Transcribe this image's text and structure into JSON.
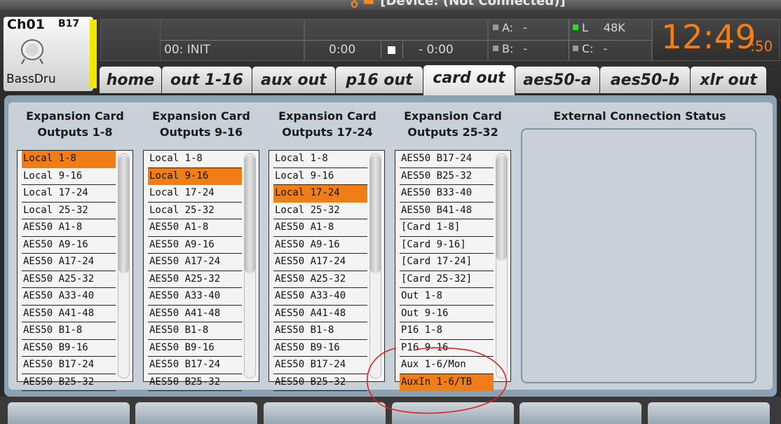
{
  "window": {
    "title": "[Device: (Not Connected)]"
  },
  "channel": {
    "number": "Ch01",
    "source": "B17",
    "name": "BassDru",
    "color": "#f3e600"
  },
  "scene": {
    "label": "00: INIT"
  },
  "transport": {
    "elapsed": "0:00",
    "remaining": "- 0:00"
  },
  "indicators": {
    "a": "A:",
    "a_val": "-",
    "b": "B:",
    "b_val": "-",
    "l": "L",
    "l_val": "48K",
    "c": "C:",
    "c_val": "-"
  },
  "clock": {
    "hm": "12:49",
    "sec": ":50",
    "color": "#f07d16"
  },
  "tabs": [
    {
      "label": "home"
    },
    {
      "label": "out 1-16"
    },
    {
      "label": "aux out"
    },
    {
      "label": "p16 out"
    },
    {
      "label": "card out",
      "active": true
    },
    {
      "label": "aes50-a"
    },
    {
      "label": "aes50-b"
    },
    {
      "label": "xlr out"
    }
  ],
  "columns": [
    {
      "title1": "Expansion Card",
      "title2": "Outputs 1-8",
      "selected": 0,
      "items": [
        "Local 1-8",
        "Local 9-16",
        "Local 17-24",
        "Local 25-32",
        "AES50 A1-8",
        "AES50 A9-16",
        "AES50 A17-24",
        "AES50 A25-32",
        "AES50 A33-40",
        "AES50 A41-48",
        "AES50 B1-8",
        "AES50 B9-16",
        "AES50 B17-24",
        "AES50 B25-32"
      ]
    },
    {
      "title1": "Expansion Card",
      "title2": "Outputs 9-16",
      "selected": 1,
      "items": [
        "Local 1-8",
        "Local 9-16",
        "Local 17-24",
        "Local 25-32",
        "AES50 A1-8",
        "AES50 A9-16",
        "AES50 A17-24",
        "AES50 A25-32",
        "AES50 A33-40",
        "AES50 A41-48",
        "AES50 B1-8",
        "AES50 B9-16",
        "AES50 B17-24",
        "AES50 B25-32"
      ]
    },
    {
      "title1": "Expansion Card",
      "title2": "Outputs 17-24",
      "selected": 2,
      "items": [
        "Local 1-8",
        "Local 9-16",
        "Local 17-24",
        "Local 25-32",
        "AES50 A1-8",
        "AES50 A9-16",
        "AES50 A17-24",
        "AES50 A25-32",
        "AES50 A33-40",
        "AES50 A41-48",
        "AES50 B1-8",
        "AES50 B9-16",
        "AES50 B17-24",
        "AES50 B25-32"
      ]
    },
    {
      "title1": "Expansion Card",
      "title2": "Outputs 25-32",
      "selected": 13,
      "items": [
        "AES50 B17-24",
        "AES50 B25-32",
        "AES50 B33-40",
        "AES50 B41-48",
        "[Card 1-8]",
        "[Card 9-16]",
        "[Card 17-24]",
        "[Card 25-32]",
        "Out 1-8",
        "Out 9-16",
        "P16 1-8",
        "P16 9-16",
        "Aux 1-6/Mon",
        "AuxIn 1-6/TB"
      ]
    }
  ],
  "external": {
    "title": "External Connection Status"
  },
  "colors": {
    "accent": "#f07d16",
    "panel": "#8ca1b2",
    "annotation": "#e02020"
  }
}
